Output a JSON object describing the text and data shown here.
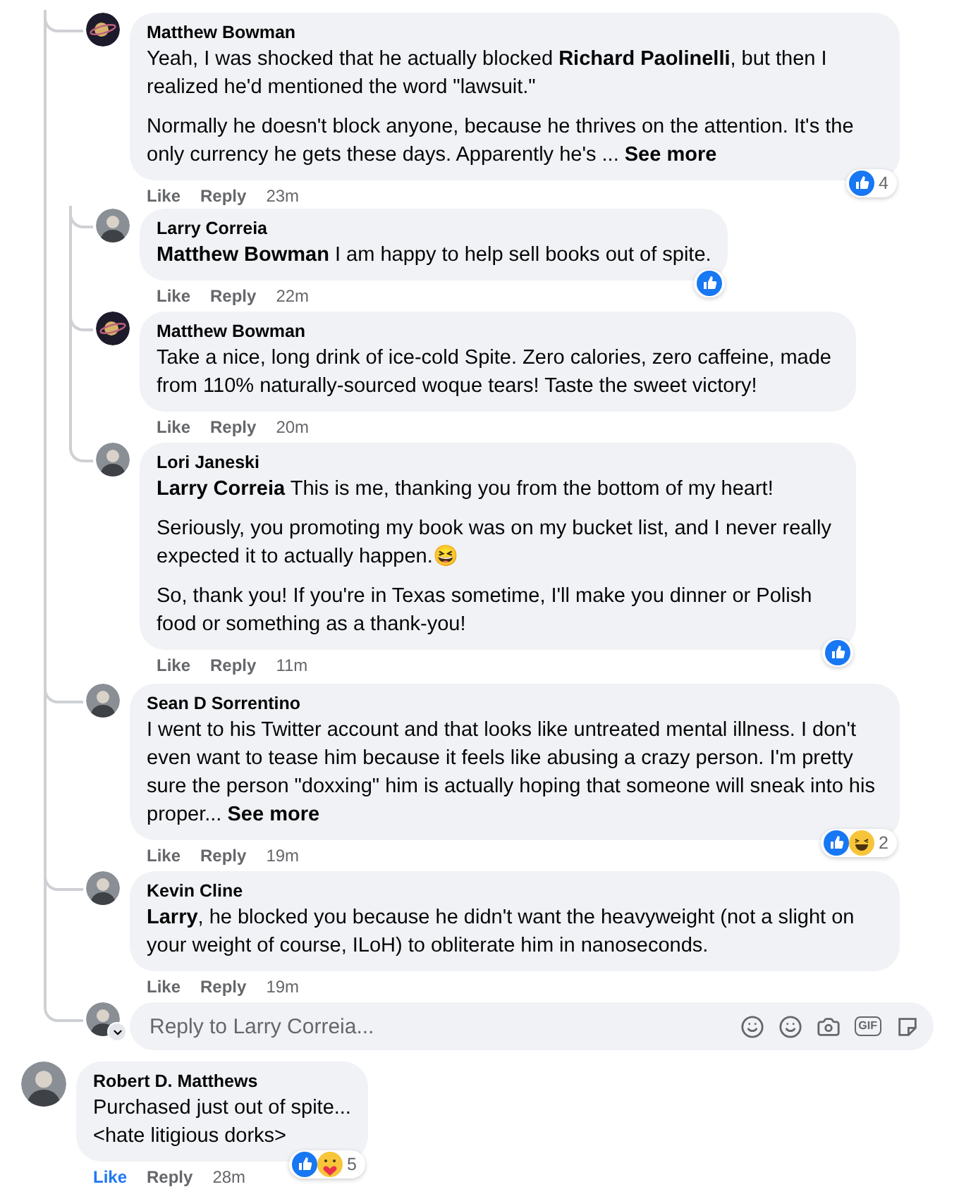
{
  "thread": {
    "replies": [
      {
        "author": "Matthew Bowman",
        "avatar": {
          "kind": "planet"
        },
        "paragraphs": [
          "Yeah, I was shocked that he actually blocked **Richard Paolinelli**, but then I realized he'd mentioned the word \"lawsuit.\"",
          "Normally he doesn't block anyone, because he thrives on the attention. It's the only currency he gets these days. Apparently he's ..."
        ],
        "see_more": "See more",
        "actions": {
          "like": "Like",
          "reply": "Reply",
          "time": "23m",
          "liked": false
        },
        "reactions": {
          "types": [
            {
              "kind": "like"
            }
          ],
          "count": "4"
        },
        "children": [
          {
            "author": "Larry Correia",
            "avatar": {
              "kind": "person"
            },
            "paragraphs": [
              "**Matthew Bowman** I am happy to help sell books out of spite."
            ],
            "actions": {
              "like": "Like",
              "reply": "Reply",
              "time": "22m",
              "liked": false
            },
            "reactions": {
              "types": [
                {
                  "kind": "like"
                }
              ]
            }
          },
          {
            "author": "Matthew Bowman",
            "avatar": {
              "kind": "planet"
            },
            "paragraphs": [
              "Take a nice, long drink of ice-cold Spite. Zero calories, zero caffeine, made from 110% naturally-sourced woque tears! Taste the sweet victory!"
            ],
            "actions": {
              "like": "Like",
              "reply": "Reply",
              "time": "20m",
              "liked": false
            }
          },
          {
            "author": "Lori Janeski",
            "avatar": {
              "kind": "person"
            },
            "paragraphs": [
              "**Larry Correia** This is me, thanking you from the bottom of my heart!",
              "Seriously, you promoting my book was on my bucket list, and I never really expected it to actually happen.😆",
              "So, thank you! If you're in Texas sometime, I'll make you dinner or Polish food or something as a thank-you!"
            ],
            "actions": {
              "like": "Like",
              "reply": "Reply",
              "time": "11m",
              "liked": false
            },
            "reactions": {
              "types": [
                {
                  "kind": "like"
                }
              ]
            }
          }
        ]
      },
      {
        "author": "Sean D Sorrentino",
        "avatar": {
          "kind": "person"
        },
        "paragraphs": [
          "I went to his Twitter account and that looks like untreated mental illness. I don't even want to tease him because it feels like abusing a crazy person. I'm pretty sure the person \"doxxing\" him is actually hoping that someone will sneak into his proper..."
        ],
        "see_more": "See more",
        "actions": {
          "like": "Like",
          "reply": "Reply",
          "time": "19m",
          "liked": false
        },
        "reactions": {
          "types": [
            {
              "kind": "like"
            },
            {
              "kind": "haha"
            }
          ],
          "count": "2"
        }
      },
      {
        "author": "Kevin Cline",
        "avatar": {
          "kind": "person"
        },
        "paragraphs": [
          "**Larry**, he blocked you because he didn't want the heavyweight (not a slight on your weight of course, ILoH) to obliterate him in nanoseconds."
        ],
        "actions": {
          "like": "Like",
          "reply": "Reply",
          "time": "19m",
          "liked": false
        }
      }
    ],
    "reply_box": {
      "placeholder": "Reply to Larry Correia...",
      "gif_label": "GIF"
    }
  },
  "comments": [
    {
      "author": "Robert D. Matthews",
      "avatar": {
        "kind": "person"
      },
      "paragraphs": [
        "Purchased just out of spite...\n<hate litigious dorks>"
      ],
      "actions": {
        "like": "Like",
        "reply": "Reply",
        "time": "28m",
        "liked": true
      },
      "reactions": {
        "types": [
          {
            "kind": "like"
          },
          {
            "kind": "care"
          }
        ],
        "count": "5"
      }
    }
  ]
}
